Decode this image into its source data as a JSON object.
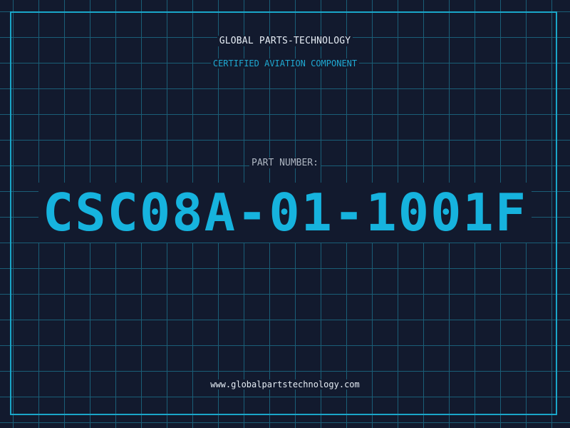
{
  "header": {
    "company": "GLOBAL PARTS-TECHNOLOGY",
    "tagline": "CERTIFIED AVIATION COMPONENT"
  },
  "part": {
    "label": "PART NUMBER:",
    "number": "CSC08A-01-1001F"
  },
  "footer": {
    "website": "www.globalpartstechnology.com"
  },
  "colors": {
    "background": "#121a2e",
    "grid": "#1a5e77",
    "accent": "#1aa6c9",
    "part_number": "#16b3de"
  }
}
